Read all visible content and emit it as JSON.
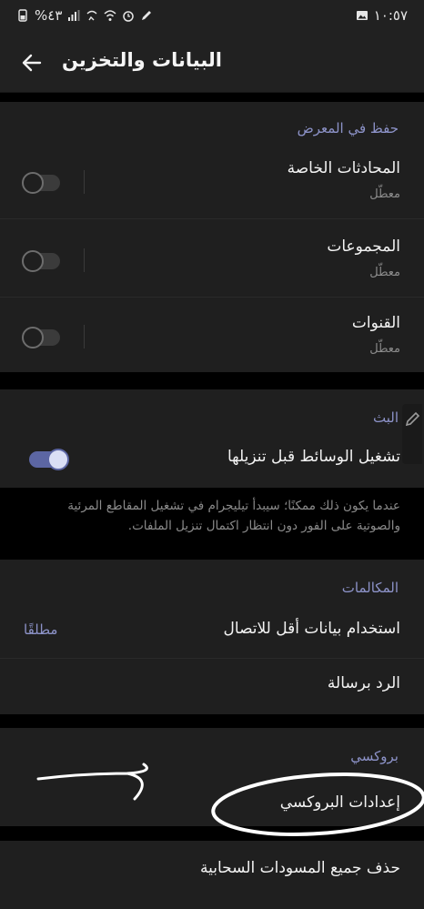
{
  "status_bar": {
    "time": "١٠:٥٧",
    "battery": "%٤٣",
    "icons": [
      "image-icon",
      "battery-icon",
      "signal-icon",
      "wifi-call-icon",
      "wifi-icon",
      "alarm-icon",
      "pen-icon"
    ]
  },
  "header": {
    "title": "البيانات والتخزين",
    "back_icon": "arrow-left-icon"
  },
  "save_to_gallery": {
    "header": "حفظ في المعرض",
    "items": [
      {
        "title": "المحادثات الخاصة",
        "subtitle": "معطّل",
        "enabled": false
      },
      {
        "title": "المجموعات",
        "subtitle": "معطّل",
        "enabled": false
      },
      {
        "title": "القنوات",
        "subtitle": "معطّل",
        "enabled": false
      }
    ]
  },
  "streaming": {
    "header": "البث",
    "item": {
      "title": "تشغيل الوسائط قبل تنزيلها",
      "enabled": true
    },
    "info": "عندما يكون ذلك ممكنًا؛ سيبدأ تيليجرام في تشغيل المقاطع المرئية والصوتية على الفور دون انتظار اكتمال تنزيل الملفات."
  },
  "calls": {
    "header": "المكالمات",
    "items": [
      {
        "title": "استخدام بيانات أقل للاتصال",
        "value": "مطلقًا"
      },
      {
        "title": "الرد برسالة"
      }
    ]
  },
  "proxy": {
    "header": "بروكسي",
    "item": {
      "title": "إعدادات البروكسي"
    }
  },
  "drafts": {
    "item": {
      "title": "حذف جميع المسودات السحابية"
    }
  },
  "colors": {
    "accent": "#8d93c9",
    "toggle_on": "#5c66a3",
    "background": "#000000",
    "section": "#1f1f1f"
  }
}
